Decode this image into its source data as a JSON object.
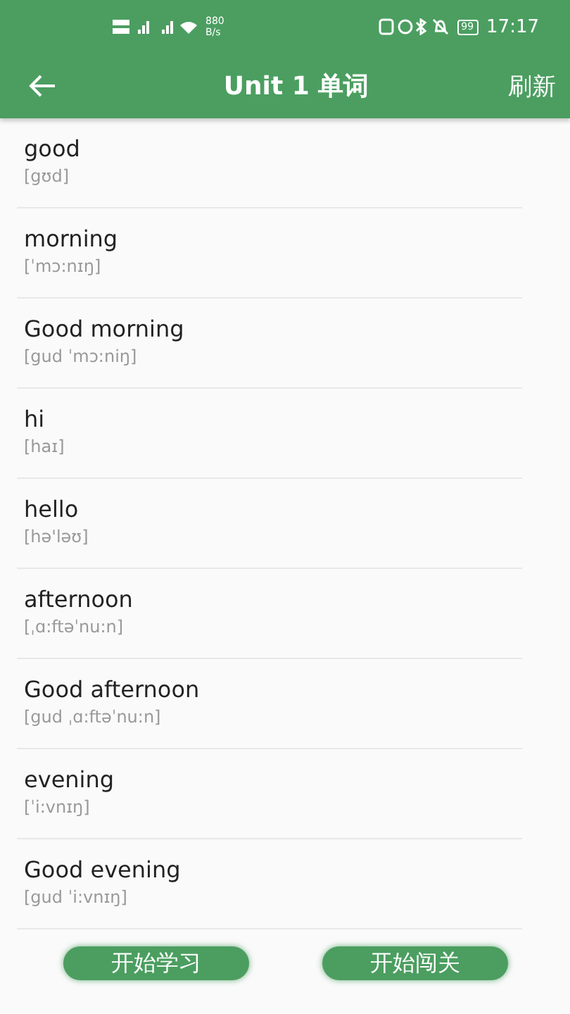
{
  "status_bar": {
    "network_speed": "880",
    "network_unit": "B/s",
    "battery": "99",
    "time": "17:17"
  },
  "app_bar": {
    "title": "Unit 1 单词",
    "action": "刷新"
  },
  "words": [
    {
      "word": "good",
      "phonetic": "[gʊd]"
    },
    {
      "word": "morning",
      "phonetic": "[ˈmɔ:nɪŋ]"
    },
    {
      "word": "Good morning",
      "phonetic": "[gud ˈmɔ:niŋ]"
    },
    {
      "word": "hi",
      "phonetic": "[haɪ]"
    },
    {
      "word": "hello",
      "phonetic": "[hə'ləʊ]"
    },
    {
      "word": "afternoon",
      "phonetic": "[ˌɑ:ftəˈnu:n]"
    },
    {
      "word": "Good afternoon",
      "phonetic": "[gud ˌɑ:ftəˈnu:n]"
    },
    {
      "word": "evening",
      "phonetic": "[ˈi:vnɪŋ]"
    },
    {
      "word": "Good evening",
      "phonetic": "[gud ˈi:vnɪŋ]"
    }
  ],
  "buttons": [
    "开始学习",
    "开始闯关"
  ]
}
